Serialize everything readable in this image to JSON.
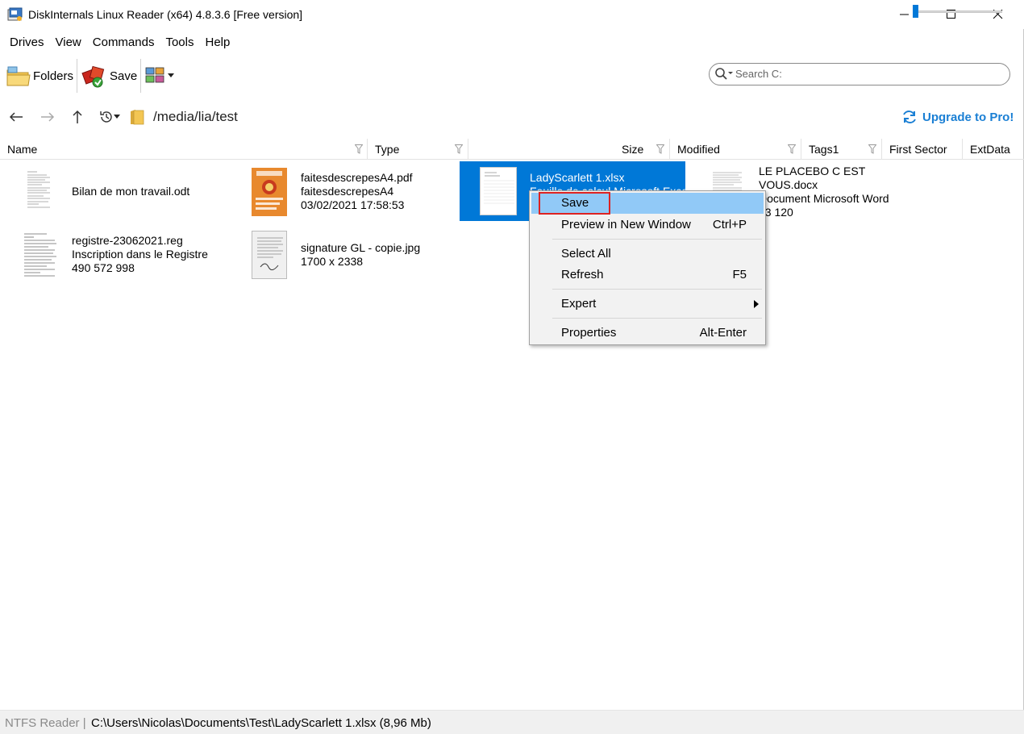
{
  "window": {
    "title": "DiskInternals Linux Reader (x64) 4.8.3.6 [Free version]"
  },
  "menu": {
    "items": [
      "Drives",
      "View",
      "Commands",
      "Tools",
      "Help"
    ]
  },
  "toolbar": {
    "folders_label": "Folders",
    "save_label": "Save",
    "search_placeholder": "Search C:"
  },
  "nav": {
    "path": "/media/lia/test",
    "upgrade_label": "Upgrade to Pro!"
  },
  "columns": [
    "Name",
    "Type",
    "Size",
    "Modified",
    "Tags1",
    "First Sector",
    "ExtData"
  ],
  "files": [
    {
      "lines": [
        "Bilan de mon travail.odt"
      ]
    },
    {
      "lines": [
        "faitesdescrepesA4.pdf",
        "faitesdescrepesA4",
        "03/02/2021 17:58:53"
      ]
    },
    {
      "lines": [
        "LadyScarlett 1.xlsx",
        "Feuille de calcul Microsoft Excel"
      ],
      "selected": true
    },
    {
      "lines": [
        "LE PLACEBO C EST",
        "VOUS.docx",
        "Document Microsoft Word",
        "23 120"
      ]
    },
    {
      "lines": [
        "registre-23062021.reg",
        "Inscription dans le Registre",
        "490 572 998"
      ]
    },
    {
      "lines": [
        "signature GL - copie.jpg",
        "1700 x 2338"
      ]
    }
  ],
  "context_menu": {
    "items": [
      {
        "label": "Save",
        "shortcut": ""
      },
      {
        "label": "Preview in New Window",
        "shortcut": "Ctrl+P"
      },
      {
        "label": "Select All",
        "shortcut": ""
      },
      {
        "label": "Refresh",
        "shortcut": "F5"
      },
      {
        "label": "Expert",
        "shortcut": ""
      },
      {
        "label": "Properties",
        "shortcut": "Alt-Enter"
      }
    ]
  },
  "status": {
    "left": "NTFS Reader |",
    "path": "C:\\Users\\Nicolas\\Documents\\Test\\LadyScarlett 1.xlsx (8,96 Mb)"
  },
  "colors": {
    "accent": "#0078d7",
    "upgrade": "#1a7fd4",
    "menu_highlight": "#91c9f7",
    "annotation_box": "#dd2222"
  }
}
